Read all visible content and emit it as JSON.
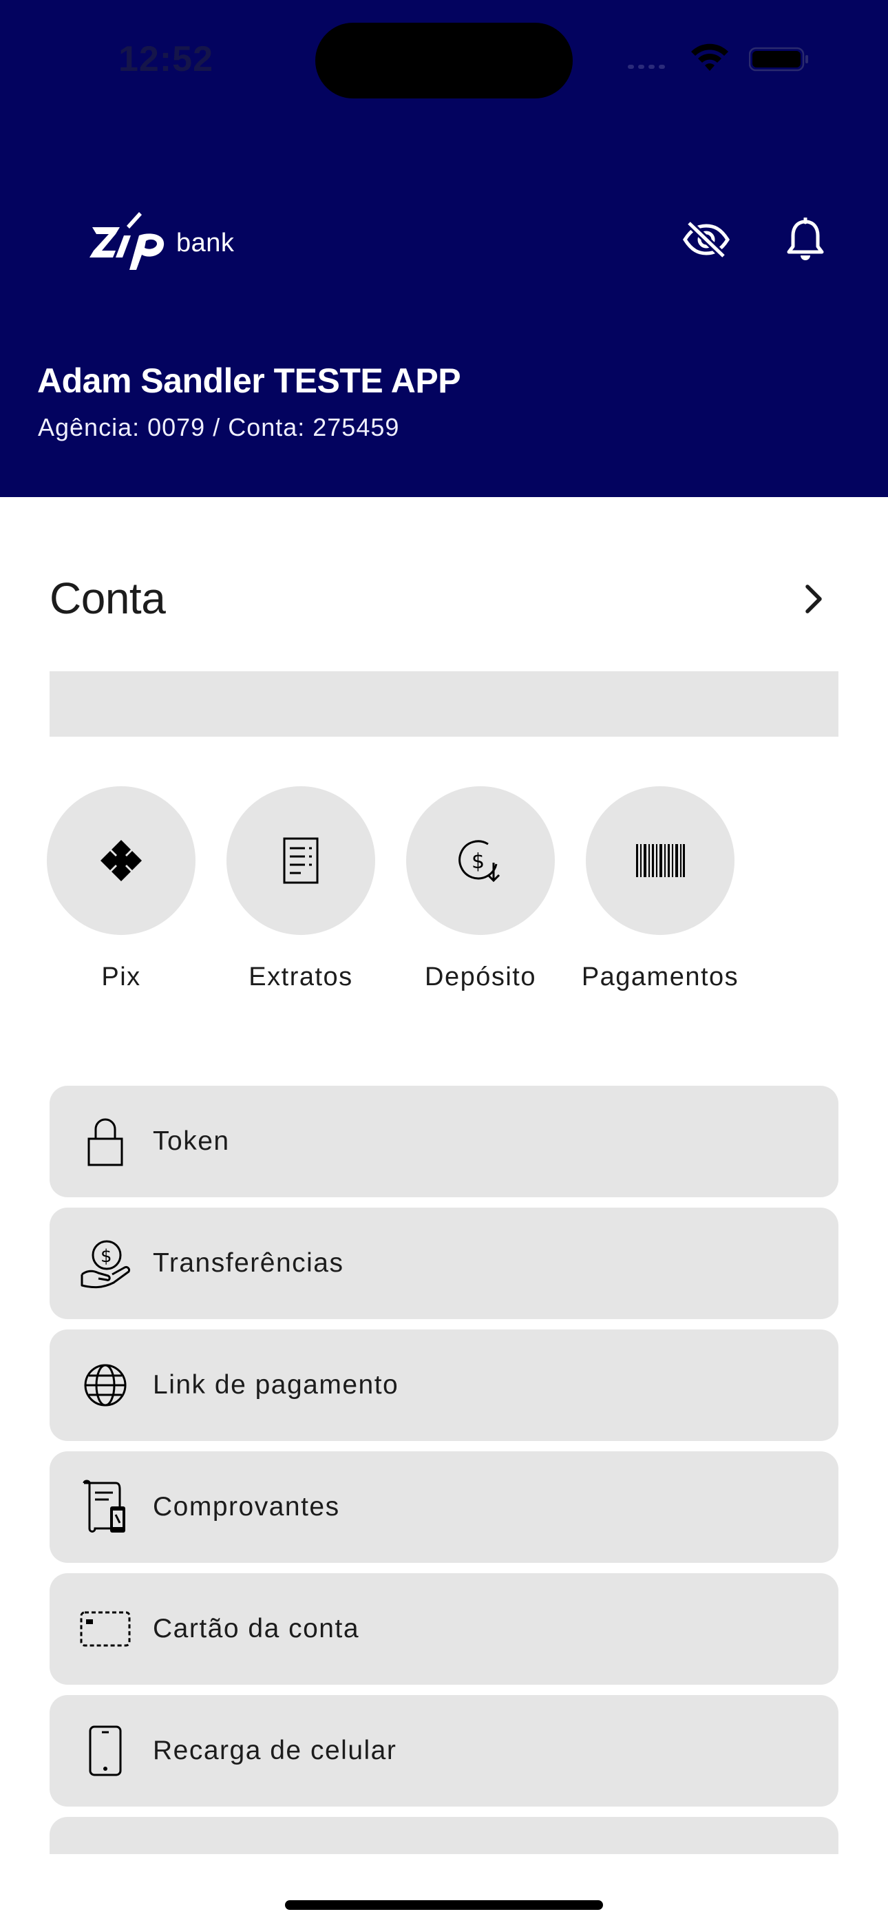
{
  "status_bar": {
    "time": "12:52"
  },
  "brand": {
    "logo_text": "bank"
  },
  "user": {
    "name": "Adam Sandler TESTE APP",
    "account_info": "Agência: 0079 / Conta: 275459"
  },
  "account_section": {
    "title": "Conta"
  },
  "quick_actions": [
    {
      "label": "Pix",
      "icon": "pix-icon"
    },
    {
      "label": "Extratos",
      "icon": "statement-icon"
    },
    {
      "label": "Depósito",
      "icon": "deposit-icon"
    },
    {
      "label": "Pagamentos",
      "icon": "barcode-icon"
    }
  ],
  "menu": [
    {
      "label": "Token",
      "icon": "lock-icon"
    },
    {
      "label": "Transferências",
      "icon": "hand-money-icon"
    },
    {
      "label": "Link de pagamento",
      "icon": "globe-icon"
    },
    {
      "label": "Comprovantes",
      "icon": "receipt-icon"
    },
    {
      "label": "Cartão da conta",
      "icon": "card-icon"
    },
    {
      "label": "Recarga de celular",
      "icon": "phone-icon"
    }
  ],
  "colors": {
    "header_bg": "#03035f",
    "surface": "#e5e5e5",
    "text": "#1c1c1c"
  }
}
